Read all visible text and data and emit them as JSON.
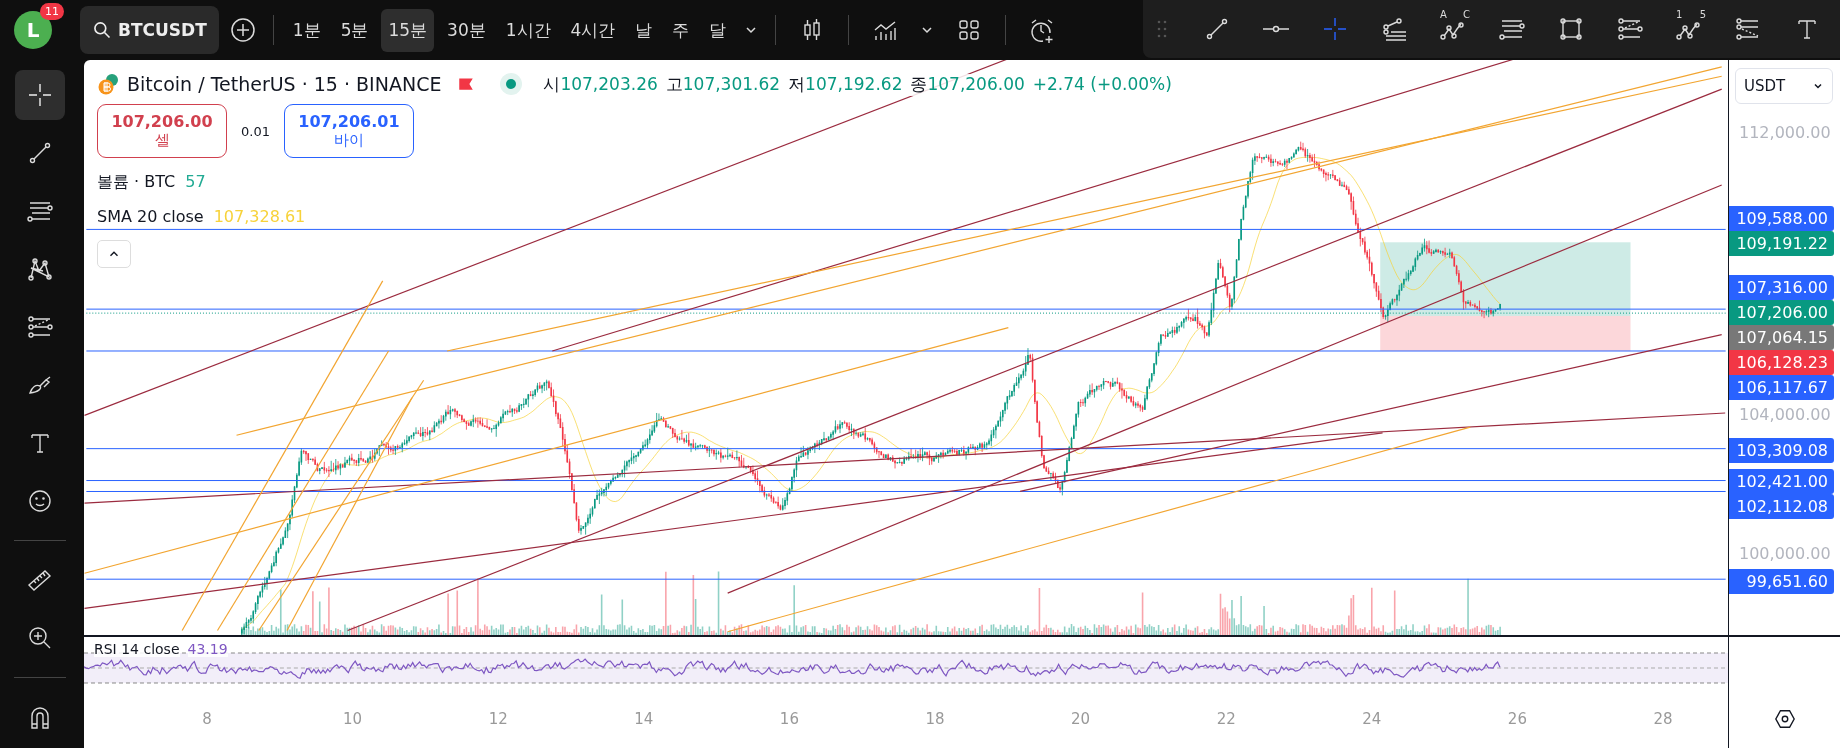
{
  "top_bar": {
    "avatar": {
      "letter": "L",
      "badge": "11"
    },
    "symbol": "BTCUSDT",
    "intervals": [
      {
        "label": "1분",
        "selected": false
      },
      {
        "label": "5분",
        "selected": false
      },
      {
        "label": "15분",
        "selected": true
      },
      {
        "label": "30분",
        "selected": false
      },
      {
        "label": "1시간",
        "selected": false
      },
      {
        "label": "4시간",
        "selected": false
      },
      {
        "label": "날",
        "selected": false
      },
      {
        "label": "주",
        "selected": false
      },
      {
        "label": "달",
        "selected": false
      }
    ]
  },
  "drawing_toolbar": {
    "tools": [
      {
        "kind": "trend-line",
        "selected": false
      },
      {
        "kind": "horizontal-line",
        "selected": false
      },
      {
        "kind": "crosshair",
        "selected": true
      },
      {
        "kind": "fib-lines",
        "selected": false
      },
      {
        "kind": "abcd-pattern",
        "selected": false,
        "marks": [
          "A",
          "C"
        ]
      },
      {
        "kind": "parallel-lines",
        "selected": false
      },
      {
        "kind": "rectangle",
        "selected": false
      },
      {
        "kind": "fib-channel",
        "selected": false
      },
      {
        "kind": "abcd-pattern",
        "selected": false,
        "marks": [
          "1",
          "5"
        ]
      },
      {
        "kind": "fib-fan",
        "selected": false
      },
      {
        "kind": "text",
        "selected": false
      }
    ]
  },
  "left_toolbar": {
    "groups": [
      [
        {
          "kind": "crosshair",
          "selected": true
        },
        {
          "kind": "trend-line",
          "selected": false
        },
        {
          "kind": "parallel-lines",
          "selected": false
        },
        {
          "kind": "xabcd-pattern",
          "selected": false
        },
        {
          "kind": "fib-channel",
          "selected": false
        },
        {
          "kind": "brush",
          "selected": false
        },
        {
          "kind": "text",
          "selected": false
        },
        {
          "kind": "emoji",
          "selected": false
        }
      ],
      [
        {
          "kind": "ruler",
          "selected": false
        },
        {
          "kind": "zoom-in",
          "selected": false
        }
      ],
      [
        {
          "kind": "magnet",
          "selected": false
        }
      ]
    ]
  },
  "legend": {
    "title": "Bitcoin / TetherUS · 15 · BINANCE",
    "ohlc": [
      {
        "label": "시",
        "value": "107,203.26"
      },
      {
        "label": "고",
        "value": "107,301.62"
      },
      {
        "label": "저",
        "value": "107,192.62"
      },
      {
        "label": "종",
        "value": "107,206.00"
      }
    ],
    "change": "+2.74 (+0.00%)",
    "sell": {
      "price": "107,206.00",
      "label": "셀"
    },
    "spread": "0.01",
    "buy": {
      "price": "107,206.01",
      "label": "바이"
    },
    "indicators": [
      {
        "name": "볼륨 · BTC",
        "value": "57",
        "color": "#22ab94"
      },
      {
        "name": "SMA 20 close",
        "value": "107,328.61",
        "color": "#f7d23a"
      }
    ]
  },
  "price_axis": {
    "currency": "USDT",
    "labels": [
      {
        "text": "112,000.00",
        "kind": "tick"
      },
      {
        "text": "109,588.00",
        "kind": "tag",
        "color": "#2962ff"
      },
      {
        "text": "109,191.22",
        "kind": "tag",
        "color": "#089981"
      },
      {
        "text": "107,316.00",
        "kind": "tag",
        "color": "#2962ff"
      },
      {
        "text": "107,206.00",
        "kind": "tag",
        "color": "#089981"
      },
      {
        "text": "107,064.15",
        "kind": "tag",
        "color": "#787878"
      },
      {
        "text": "106,128.23",
        "kind": "tag",
        "color": "#f23645"
      },
      {
        "text": "106,117.67",
        "kind": "tag",
        "color": "#2962ff"
      },
      {
        "text": "104,000.00",
        "kind": "tick"
      },
      {
        "text": "103,309.08",
        "kind": "tag",
        "color": "#2962ff"
      },
      {
        "text": "102,421.00",
        "kind": "tag",
        "color": "#2962ff"
      },
      {
        "text": "102,112.08",
        "kind": "tag",
        "color": "#2962ff"
      },
      {
        "text": "100,000.00",
        "kind": "tick"
      },
      {
        "text": "99,651.60",
        "kind": "tag",
        "color": "#2962ff"
      }
    ]
  },
  "rsi": {
    "label": "RSI 14 close",
    "value": "43.19"
  },
  "time_axis": {
    "labels": [
      "8",
      "10",
      "12",
      "14",
      "16",
      "18",
      "20",
      "22",
      "24",
      "26",
      "28"
    ]
  }
}
